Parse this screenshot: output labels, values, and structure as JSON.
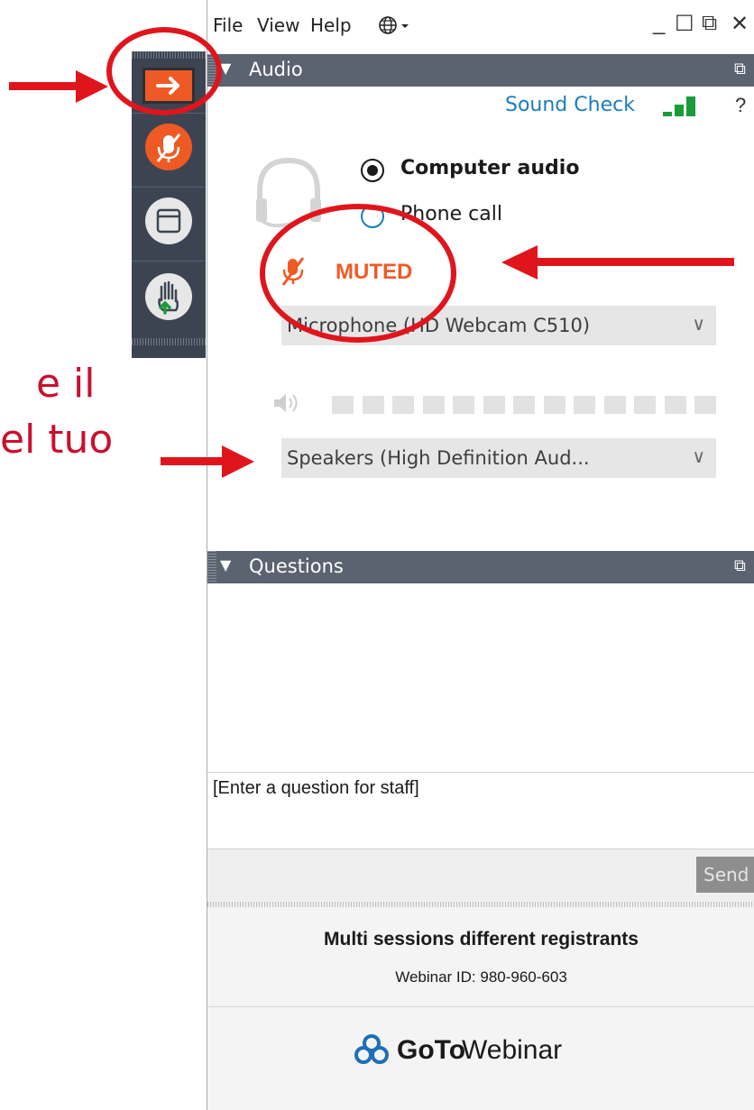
{
  "annotation": {
    "line1": "e il",
    "line2": "el tuo"
  },
  "menu": {
    "file": "File",
    "view": "View",
    "help": "Help"
  },
  "window_controls": {
    "minimize": "_",
    "maximize": "☐",
    "restore": "⧉",
    "close": "✕"
  },
  "audio_panel": {
    "title": "Audio",
    "sound_check": "Sound Check",
    "help": "?",
    "options": [
      "Computer audio",
      "Phone call"
    ],
    "selected_option": "Computer audio",
    "status": "MUTED",
    "microphone": "Microphone (HD Webcam C510)",
    "speakers": "Speakers (High Definition Aud...",
    "speaker_level_segments": 13
  },
  "questions_panel": {
    "title": "Questions",
    "input_placeholder": "[Enter a question for staff]",
    "send_label": "Send"
  },
  "footer": {
    "webinar_title": "Multi sessions different registrants",
    "webinar_id": "Webinar ID: 980-960-603",
    "brand_bold": "GoTo",
    "brand_light": "Webinar"
  },
  "icons": {
    "toolbar": [
      "arrow-right-icon",
      "muted-mic-icon",
      "window-icon",
      "raise-hand-icon"
    ],
    "headset": "headset-icon",
    "globe": "globe-icon"
  },
  "colors": {
    "accent_orange": "#ef5a24",
    "sound_check_blue": "#1a7cc1",
    "signal_green": "#1a9b3a",
    "annotation_red": "#e0151c",
    "panel_header": "#5b6270",
    "toolbar_bg": "#3c4452"
  }
}
